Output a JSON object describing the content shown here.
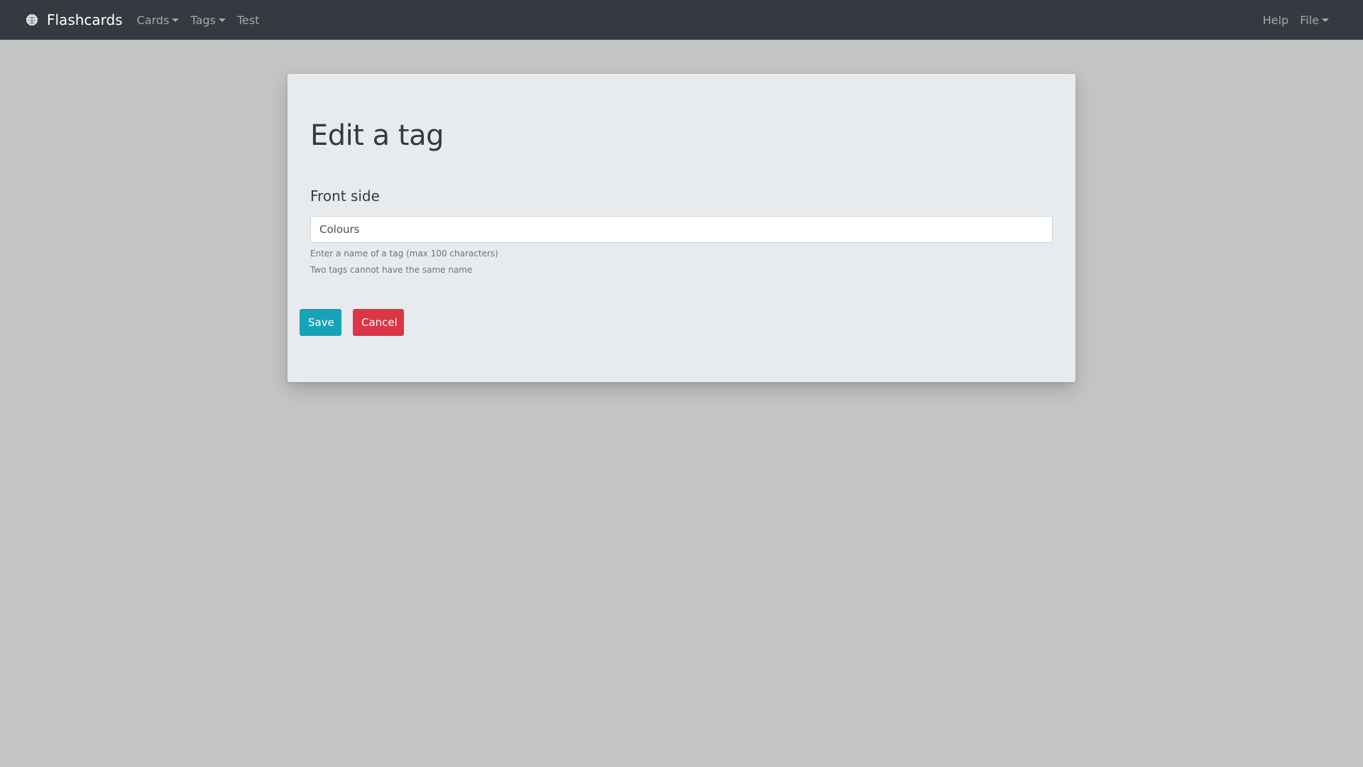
{
  "navbar": {
    "brand": "Flashcards",
    "brand_icon": "brain-icon",
    "items": [
      {
        "label": "Cards",
        "dropdown": true
      },
      {
        "label": "Tags",
        "dropdown": true
      },
      {
        "label": "Test",
        "dropdown": false
      }
    ],
    "right_items": [
      {
        "label": "Help",
        "dropdown": false
      },
      {
        "label": "File",
        "dropdown": true
      }
    ]
  },
  "form": {
    "title": "Edit a tag",
    "field_label": "Front side",
    "input_value": "Colours",
    "help_lines": [
      "Enter a name of a tag (max 100 characters)",
      "Two tags cannot have the same name"
    ],
    "save_label": "Save",
    "cancel_label": "Cancel"
  },
  "colors": {
    "navbar_bg": "#343a40",
    "page_bg": "#c4c4c4",
    "card_bg": "#e8ebee",
    "save_button": "#17a2b8",
    "cancel_button": "#dc3545"
  }
}
